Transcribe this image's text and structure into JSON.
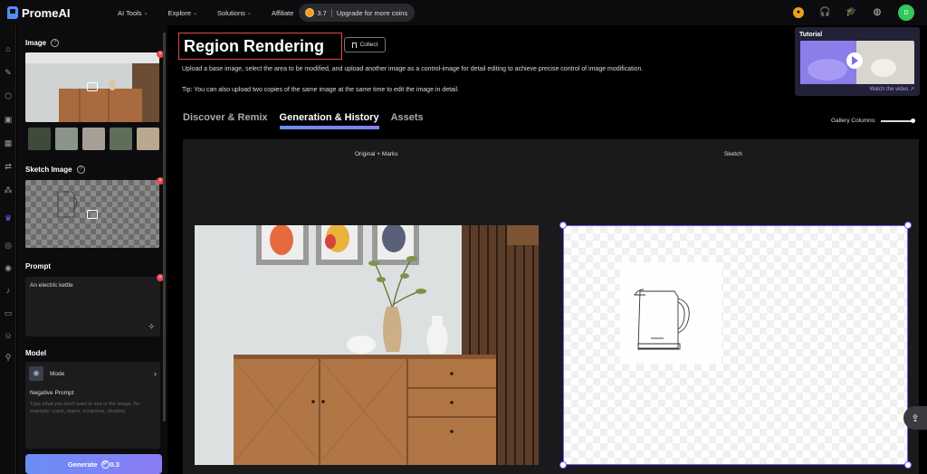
{
  "brand": {
    "name": "PromeAI"
  },
  "nav": {
    "items": [
      {
        "label": "AI Tools",
        "chevron": true
      },
      {
        "label": "Explore",
        "chevron": true
      },
      {
        "label": "Solutions",
        "chevron": true
      },
      {
        "label": "Affiliate",
        "chevron": false
      }
    ],
    "coins": {
      "value": "3.7",
      "upgrade_label": "Upgrade for more coins"
    },
    "avatar_letter": "D",
    "right_icons": [
      "coin-icon",
      "headset-icon",
      "graduation-cap-icon",
      "globe-icon"
    ]
  },
  "rail": {
    "icons": [
      "home-icon",
      "brush-icon",
      "cube-icon",
      "image-icon",
      "grid-icon",
      "swap-icon",
      "apps-icon",
      "crown-icon",
      "compass-icon",
      "target-icon",
      "bell-icon",
      "folder-icon",
      "user-icon",
      "run-icon"
    ],
    "active": "crown-icon"
  },
  "panel": {
    "image_label": "Image",
    "sketch_label": "Sketch Image",
    "prompt_label": "Prompt",
    "prompt_value": "An electric kettle",
    "model_label": "Model",
    "model_value": "Mode",
    "negative_label": "Negative Prompt",
    "negative_placeholder": "Type what you don't want to see in the image, for example: crack, stains, scratches, shadow,",
    "generate_label": "Generate",
    "generate_cost": "0.3"
  },
  "main": {
    "title": "Region Rendering",
    "collect_label": "Collect",
    "description": "Upload a base image, select the area to be modified, and upload another image as a control-image for detail editing to achieve precise control of image modification.",
    "tip": "Tip: You can also upload two copies of the same image at the same time to edit the image in detail.",
    "tabs": [
      {
        "label": "Discover & Remix",
        "active": false
      },
      {
        "label": "Generation & History",
        "active": true
      },
      {
        "label": "Assets",
        "active": false
      }
    ],
    "gallery_columns_label": "Gallery Columns:",
    "col_left": "Original + Marks",
    "col_right": "Sketch"
  },
  "tutorial": {
    "title": "Tutorial",
    "watch_label": "Watch the video ↗"
  },
  "colors": {
    "accent": "#7b5cf6",
    "danger": "#e5484d",
    "coin": "#f0a020",
    "avatar": "#34c759"
  }
}
